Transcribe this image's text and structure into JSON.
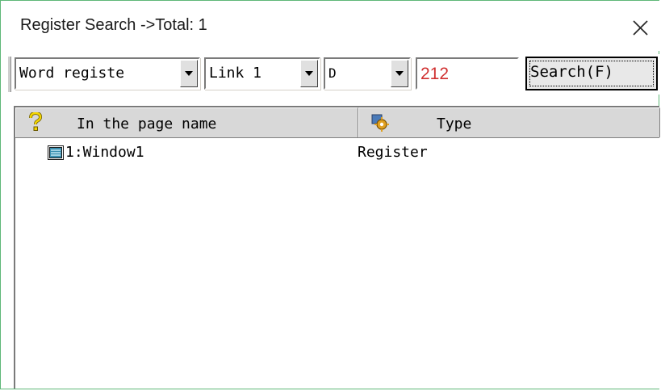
{
  "window": {
    "title": "Register Search ->Total: 1",
    "close_icon": "close-icon"
  },
  "toolbar": {
    "register_type": "Word registe",
    "link": "Link 1",
    "device": "D",
    "address": "212",
    "search_label": "Search(F)",
    "address_color": "#d03030"
  },
  "list": {
    "columns": [
      {
        "label": "In the page name",
        "icon": "question-icon"
      },
      {
        "label": "Type",
        "icon": "gear-icon"
      }
    ],
    "rows": [
      {
        "page": "1:Window1",
        "type": "Register",
        "icon": "window-icon"
      }
    ]
  }
}
